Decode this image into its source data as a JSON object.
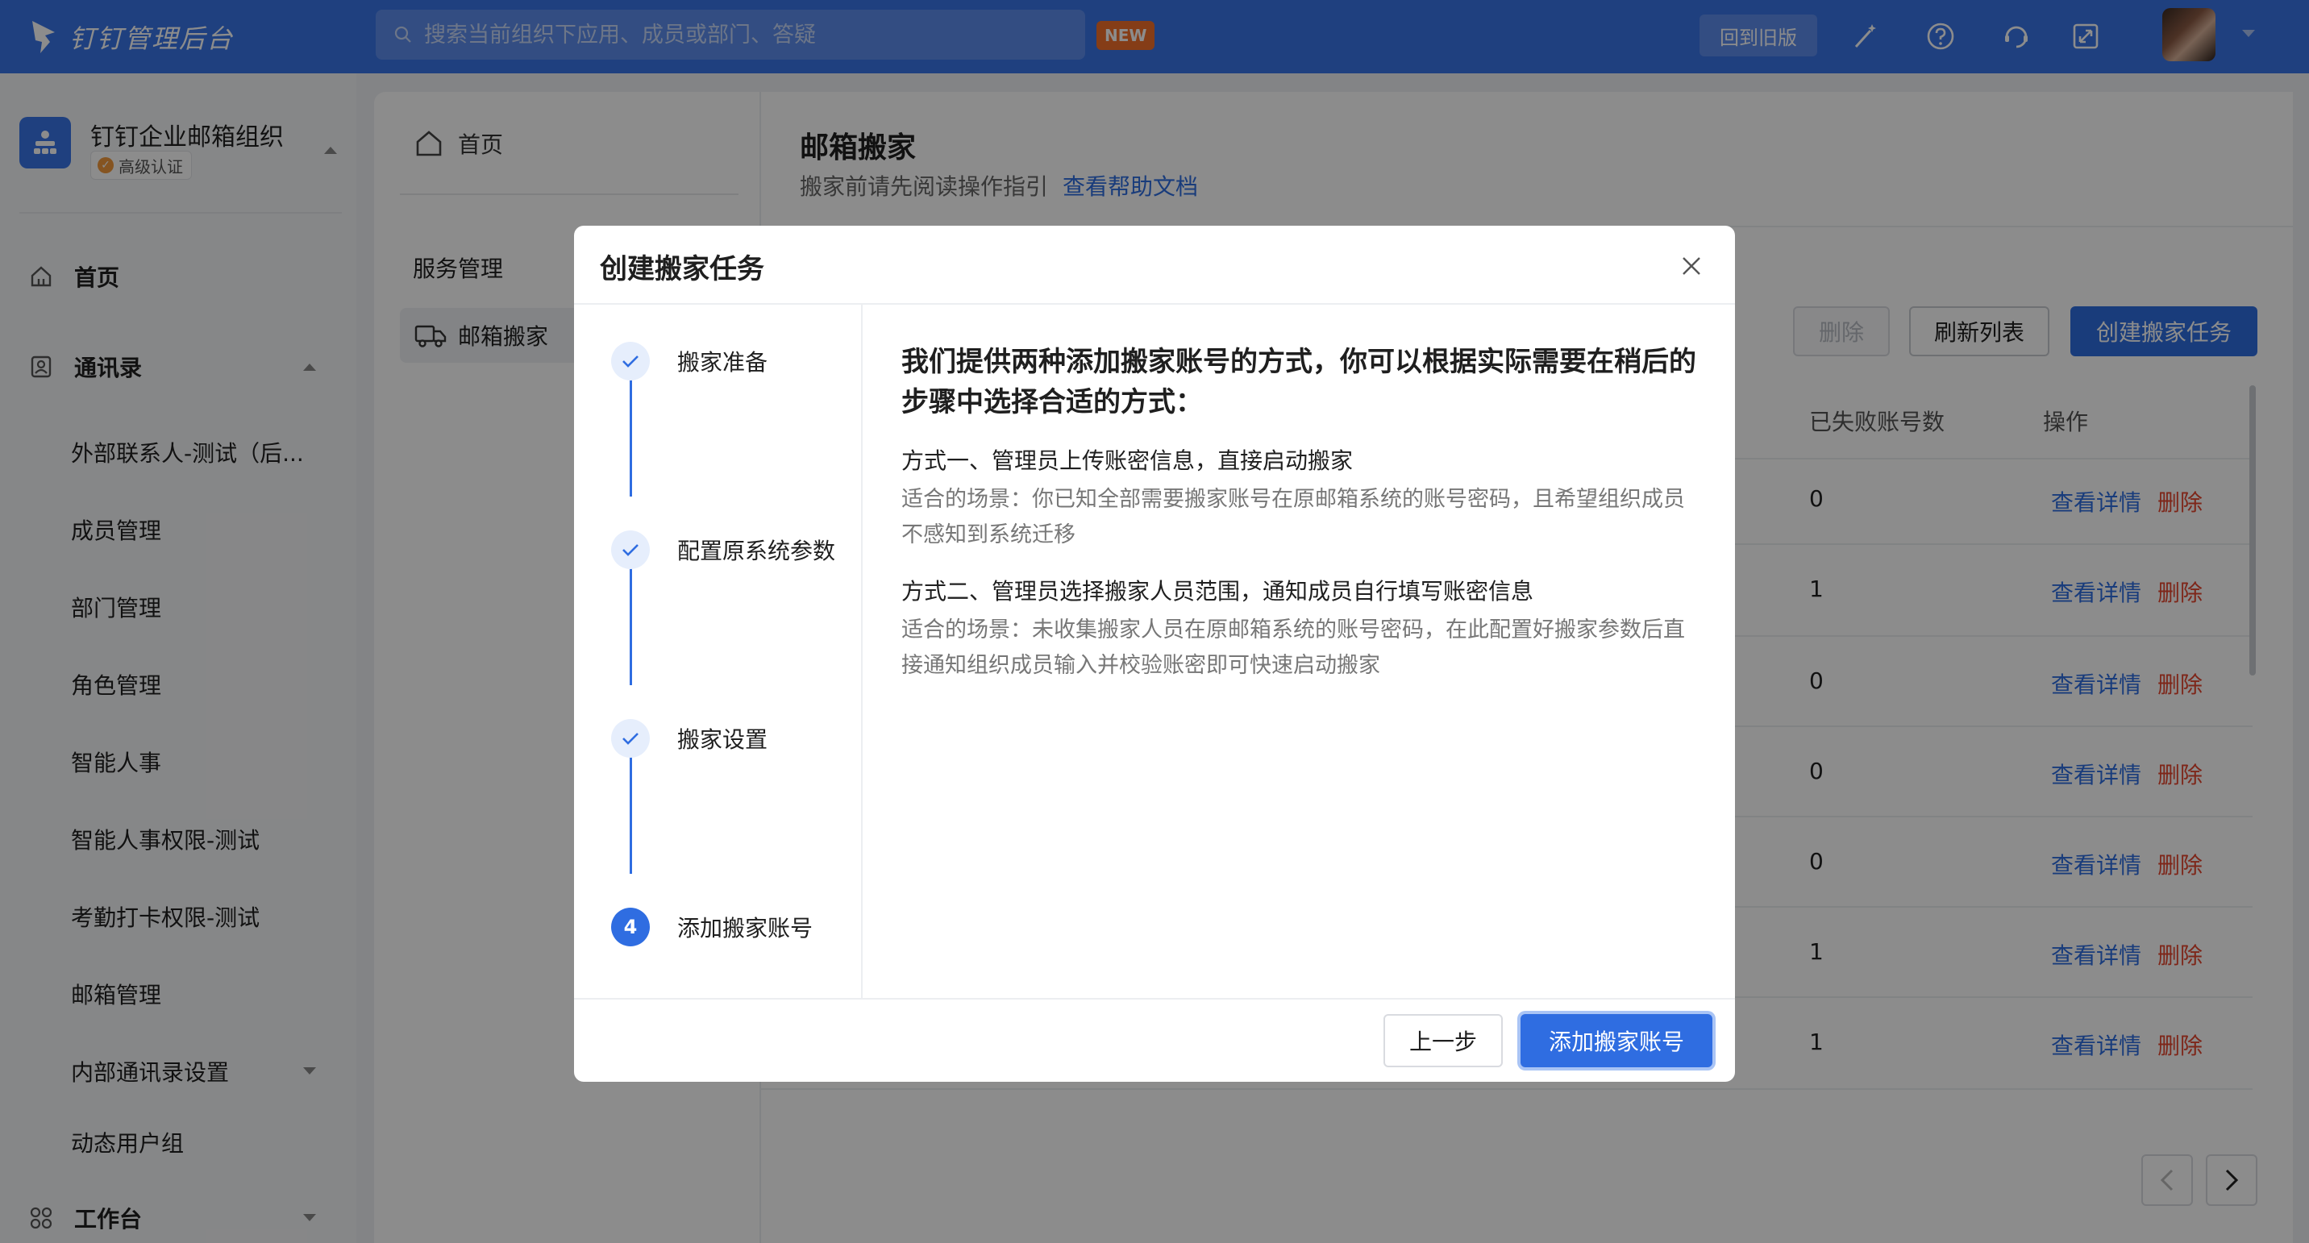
{
  "topbar": {
    "app_title": "钉钉管理后台",
    "search_placeholder": "搜索当前组织下应用、成员或部门、答疑",
    "new_badge": "NEW",
    "old_version": "回到旧版"
  },
  "sidebar": {
    "org_name": "钉钉企业邮箱组织",
    "org_badge": "高级认证",
    "items": [
      {
        "label": "首页",
        "icon": "home-icon"
      },
      {
        "label": "通讯录",
        "icon": "contacts-icon"
      },
      {
        "label": "外部联系人-测试（后..."
      },
      {
        "label": "成员管理"
      },
      {
        "label": "部门管理"
      },
      {
        "label": "角色管理"
      },
      {
        "label": "智能人事"
      },
      {
        "label": "智能人事权限-测试"
      },
      {
        "label": "考勤打卡权限-测试"
      },
      {
        "label": "邮箱管理"
      },
      {
        "label": "内部通讯录设置"
      },
      {
        "label": "动态用户组"
      },
      {
        "label": "工作台",
        "icon": "workbench-icon"
      }
    ]
  },
  "subnav": {
    "home": "首页",
    "section": "服务管理",
    "active_item": "邮箱搬家"
  },
  "main": {
    "title": "邮箱搬家",
    "subtitle": "搬家前请先阅读操作指引",
    "help_link": "查看帮助文档",
    "buttons": {
      "delete": "删除",
      "refresh": "刷新列表",
      "create": "创建搬家任务"
    },
    "columns": {
      "failed": "已失败账号数",
      "ops": "操作"
    },
    "rows": [
      {
        "failed": "0",
        "view": "查看详情",
        "del": "删除"
      },
      {
        "failed": "1",
        "view": "查看详情",
        "del": "删除"
      },
      {
        "failed": "0",
        "view": "查看详情",
        "del": "删除"
      },
      {
        "failed": "0",
        "view": "查看详情",
        "del": "删除"
      },
      {
        "failed": "0",
        "view": "查看详情",
        "del": "删除"
      },
      {
        "failed": "1",
        "view": "查看详情",
        "del": "删除"
      },
      {
        "failed": "1",
        "view": "查看详情",
        "del": "删除"
      }
    ]
  },
  "dialog": {
    "title": "创建搬家任务",
    "steps": [
      {
        "label": "搬家准备",
        "state": "done"
      },
      {
        "label": "配置原系统参数",
        "state": "done"
      },
      {
        "label": "搬家设置",
        "state": "done"
      },
      {
        "label": "添加搬家账号",
        "state": "current",
        "number": "4"
      }
    ],
    "heading": "我们提供两种添加搬家账号的方式，你可以根据实际需要在稍后的步骤中选择合适的方式：",
    "method1_title": "方式一、管理员上传账密信息，直接启动搬家",
    "method1_desc": "适合的场景：你已知全部需要搬家账号在原邮箱系统的账号密码，且希望组织成员不感知到系统迁移",
    "method2_title": "方式二、管理员选择搬家人员范围，通知成员自行填写账密信息",
    "method2_desc": "适合的场景：未收集搬家人员在原邮箱系统的账号密码，在此配置好搬家参数后直接通知组织成员输入并校验账密即可快速启动搬家",
    "prev_button": "上一步",
    "next_button": "添加搬家账号"
  },
  "colors": {
    "primary": "#3a75e8",
    "link": "#2f6de1",
    "danger": "#e5452e",
    "badge": "#f36f2a"
  }
}
